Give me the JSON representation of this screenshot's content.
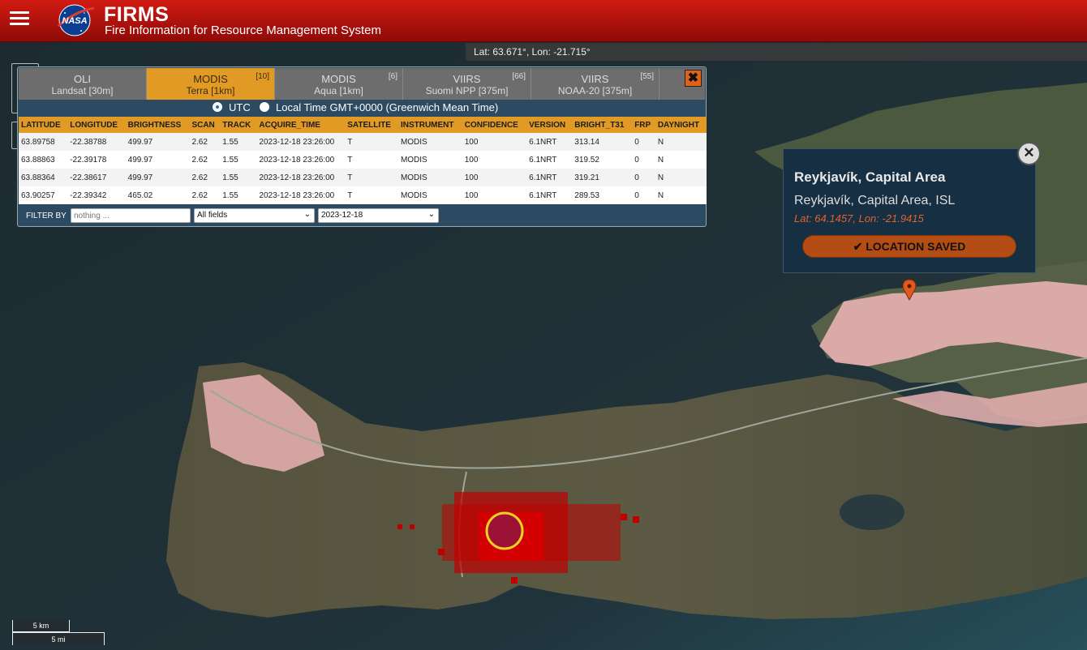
{
  "header": {
    "logo_text": "NASA",
    "title": "FIRMS",
    "subtitle": "Fire Information for Resource Management System"
  },
  "map": {
    "cursor_coords": "Lat: 63.671°, Lon: -21.715°",
    "scale_km": "5 km",
    "scale_mi": "5 mi"
  },
  "panel": {
    "tabs": [
      {
        "line1": "OLI",
        "line2": "Landsat [30m]",
        "count": ""
      },
      {
        "line1": "MODIS",
        "line2": "Terra [1km]",
        "count": "[10]"
      },
      {
        "line1": "MODIS",
        "line2": "Aqua [1km]",
        "count": "[6]"
      },
      {
        "line1": "VIIRS",
        "line2": "Suomi NPP [375m]",
        "count": "[66]"
      },
      {
        "line1": "VIIRS",
        "line2": "NOAA-20 [375m]",
        "count": "[55]"
      }
    ],
    "close_icon": "✖",
    "time_utc": "UTC",
    "time_local": "Local Time GMT+0000 (Greenwich Mean Time)",
    "columns": [
      "LATITUDE",
      "LONGITUDE",
      "BRIGHTNESS",
      "SCAN",
      "TRACK",
      "ACQUIRE_TIME",
      "SATELLITE",
      "INSTRUMENT",
      "CONFIDENCE",
      "VERSION",
      "BRIGHT_T31",
      "FRP",
      "DAYNIGHT"
    ],
    "rows": [
      [
        "63.89758",
        "-22.38788",
        "499.97",
        "2.62",
        "1.55",
        "2023-12-18 23:26:00",
        "T",
        "MODIS",
        "100",
        "6.1NRT",
        "313.14",
        "0",
        "N"
      ],
      [
        "63.88863",
        "-22.39178",
        "499.97",
        "2.62",
        "1.55",
        "2023-12-18 23:26:00",
        "T",
        "MODIS",
        "100",
        "6.1NRT",
        "319.52",
        "0",
        "N"
      ],
      [
        "63.88364",
        "-22.38617",
        "499.97",
        "2.62",
        "1.55",
        "2023-12-18 23:26:00",
        "T",
        "MODIS",
        "100",
        "6.1NRT",
        "319.21",
        "0",
        "N"
      ],
      [
        "63.90257",
        "-22.39342",
        "465.02",
        "2.62",
        "1.55",
        "2023-12-18 23:26:00",
        "T",
        "MODIS",
        "100",
        "6.1NRT",
        "289.53",
        "0",
        "N"
      ]
    ],
    "filter_label": "FILTER BY",
    "filter_placeholder": "nothing ...",
    "field_select": "All fields",
    "date_select": "2023-12-18"
  },
  "popup": {
    "close_icon": "✕",
    "title": "Reykjavík, Capital Area",
    "subtitle": "Reykjavík, Capital Area, ISL",
    "coords": "Lat: 64.1457, Lon: -21.9415",
    "button_label": "✔ LOCATION SAVED"
  },
  "colors": {
    "header": "#b5120d",
    "accent": "#e19b24",
    "panel": "#2c4a61",
    "fire": "#c80000",
    "saved_button": "#b34d14"
  }
}
